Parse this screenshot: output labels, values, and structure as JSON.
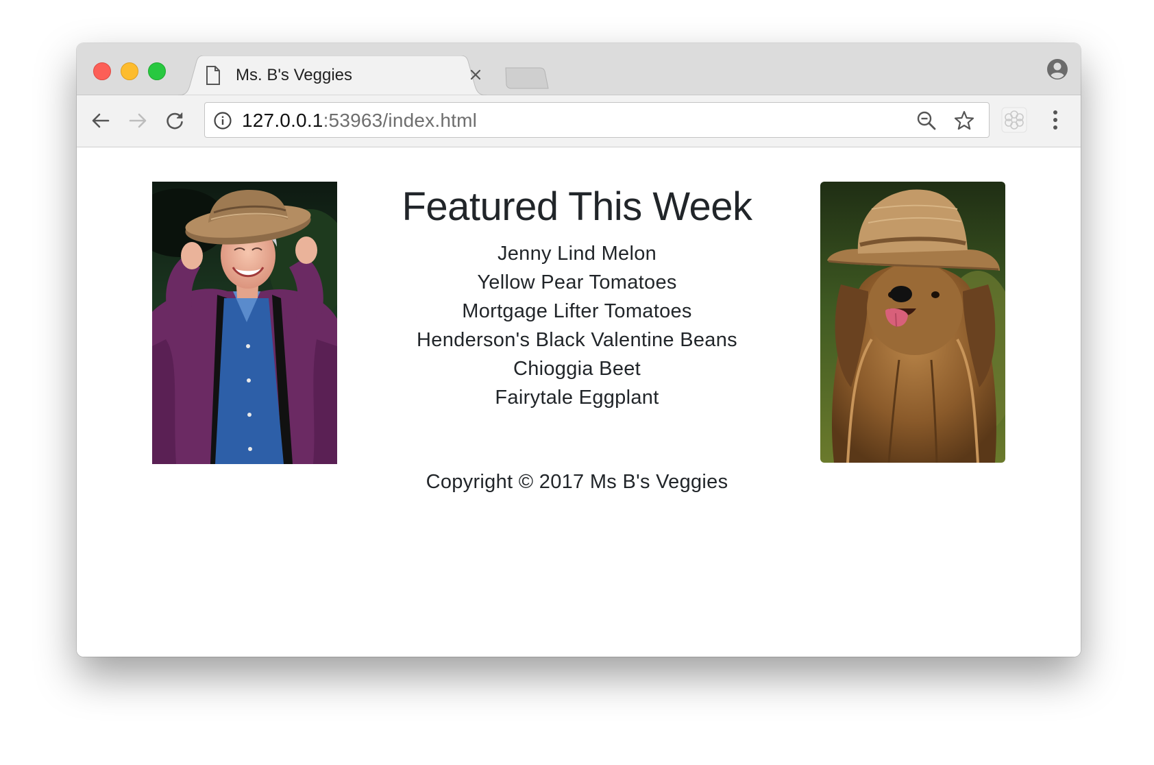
{
  "browser": {
    "tab": {
      "title": "Ms. B's Veggies",
      "close_label": "×"
    },
    "address_bar": {
      "host": "127.0.0.1",
      "path": ":53963/index.html"
    },
    "icons": {
      "back": "back-arrow-icon",
      "forward": "forward-arrow-icon",
      "reload": "reload-icon",
      "info": "info-icon",
      "zoom": "zoom-out-icon",
      "bookmark": "star-icon",
      "extension": "extension-icon",
      "menu": "more-menu-icon",
      "profile": "profile-icon"
    }
  },
  "page": {
    "heading": "Featured This Week",
    "items": [
      "Jenny Lind Melon",
      "Yellow Pear Tomatoes",
      "Mortgage Lifter Tomatoes",
      "Henderson's Black Valentine Beans",
      "Chioggia Beet",
      "Fairytale Eggplant"
    ],
    "copyright": "Copyright © 2017 Ms B's Veggies"
  },
  "colors": {
    "text": "#212529",
    "traffic_red": "#fc5f57",
    "traffic_yellow": "#fdbc2e",
    "traffic_green": "#28c840"
  }
}
